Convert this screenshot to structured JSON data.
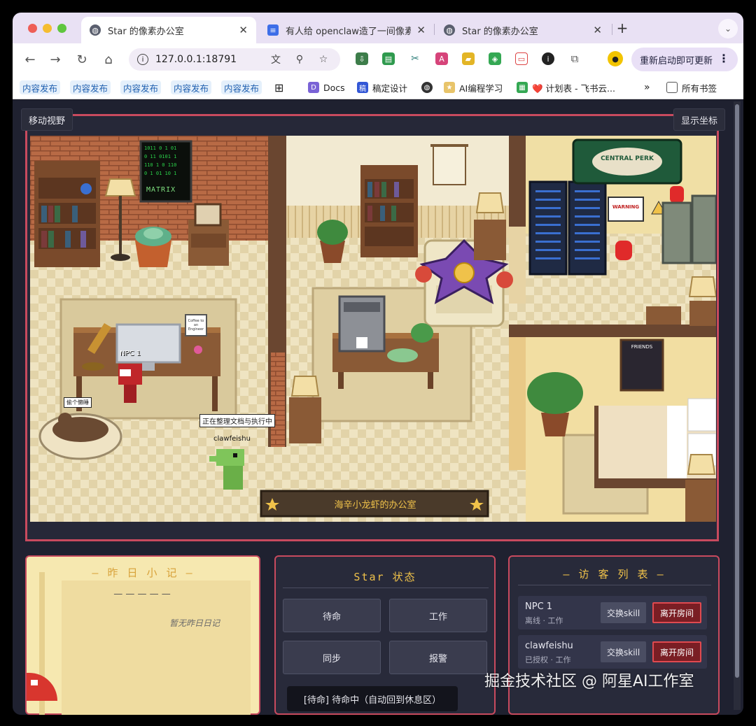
{
  "tabs": [
    {
      "title": "Star 的像素办公室",
      "active": true
    },
    {
      "title": "有人给 openclaw造了一间像素",
      "active": false
    },
    {
      "title": "Star 的像素办公室",
      "active": false
    }
  ],
  "toolbar": {
    "url": "127.0.0.1:18791",
    "update_label": "重新启动即可更新"
  },
  "bookmarks": {
    "pills": [
      "内容发布",
      "内容发布",
      "内容发布",
      "内容发布",
      "内容发布"
    ],
    "items": [
      "Docs",
      "稿定设计",
      "AI编程学习",
      "❤️ 计划表 - 飞书云..."
    ],
    "all_label": "所有书签"
  },
  "hud": {
    "move_view": "移动视野",
    "show_coords": "显示坐标"
  },
  "scene": {
    "poster_text": "MATRIX",
    "sign_text": "CENTRAL PERK",
    "warning_text": "WARNING",
    "friends_text": "FRIENDS",
    "mug_text": "Coffee to an Engineer",
    "cat_label": "偷个懒睡",
    "npc1_name": "NPC 1",
    "speech": "正在整理文档与执行中",
    "agent_name": "clawfeishu",
    "banner": "海辛小龙虾的办公室"
  },
  "memo": {
    "title": "— 昨 日 小 记 —",
    "dashes": "— — — — —",
    "empty": "暂无昨日日记"
  },
  "status": {
    "title": "Star 状态",
    "buttons": [
      "待命",
      "工作",
      "同步",
      "报警"
    ]
  },
  "visitors": {
    "title": "— 访 客 列 表 —",
    "list": [
      {
        "name": "NPC 1",
        "status": "离线 · 工作",
        "swap": "交换skill",
        "leave": "离开房间"
      },
      {
        "name": "clawfeishu",
        "status": "已授权 · 工作",
        "swap": "交换skill",
        "leave": "离开房间"
      }
    ]
  },
  "toast": "[待命] 待命中（自动回到休息区）",
  "watermark": "掘金技术社区 @ 阿星AI工作室"
}
